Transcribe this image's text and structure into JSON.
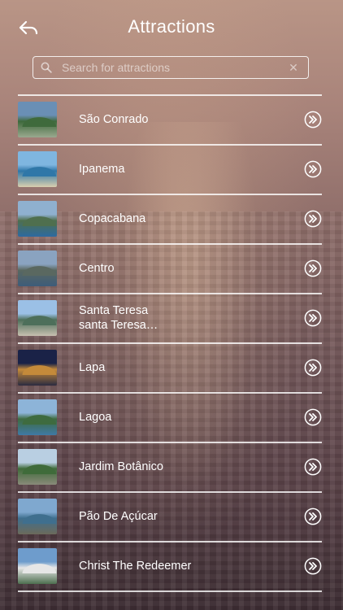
{
  "header": {
    "title": "Attractions",
    "back_icon": "back-arrow-icon"
  },
  "search": {
    "placeholder": "Search for attractions",
    "value": "",
    "clear_icon": "close-icon"
  },
  "attractions": [
    {
      "name": "São Conrado",
      "thumb": [
        "#6a8fb5",
        "#3f6a3c",
        "#9aa98f"
      ]
    },
    {
      "name": "Ipanema",
      "thumb": [
        "#7fb6e0",
        "#2f77a8",
        "#d9cfae"
      ]
    },
    {
      "name": "Copacabana",
      "thumb": [
        "#8fb0cf",
        "#4f6f4e",
        "#2d6aa0"
      ]
    },
    {
      "name": "Centro",
      "thumb": [
        "#8aa3c0",
        "#5a6860",
        "#3d5c7a"
      ]
    },
    {
      "name": "Santa Teresa\nsanta Teresa…",
      "thumb": [
        "#9bc0e6",
        "#4d6f5a",
        "#c8c0b0"
      ]
    },
    {
      "name": "Lapa",
      "thumb": [
        "#1a2247",
        "#c48a3a",
        "#2b2b40"
      ]
    },
    {
      "name": "Lagoa",
      "thumb": [
        "#8db4d8",
        "#3e6b3f",
        "#3f79a6"
      ]
    },
    {
      "name": "Jardim Botânico",
      "thumb": [
        "#b9cfe2",
        "#3f6b3a",
        "#8a8a7a"
      ]
    },
    {
      "name": "Pão De Açúcar",
      "thumb": [
        "#7fa8cf",
        "#3f6f8e",
        "#6c6a5a"
      ]
    },
    {
      "name": "Christ The Redeemer",
      "thumb": [
        "#6e9ccc",
        "#e6e6e6",
        "#4d6f4f"
      ]
    }
  ]
}
